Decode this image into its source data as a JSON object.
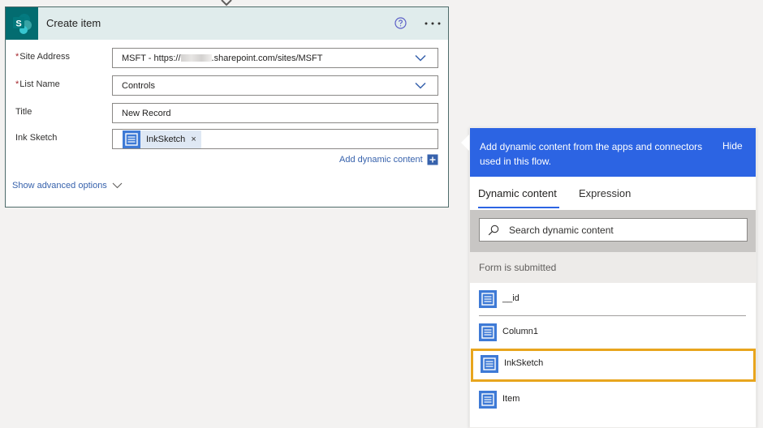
{
  "card": {
    "title": "Create item",
    "icons": {
      "logo": "sharepoint-logo",
      "help": "help-circle-icon",
      "more": "more-options-icon"
    },
    "fields": {
      "site_address": {
        "label": "Site Address",
        "required": "*",
        "value_prefix": "MSFT - https://",
        "value_suffix": ".sharepoint.com/sites/MSFT"
      },
      "list_name": {
        "label": "List Name",
        "required": "*",
        "value": "Controls"
      },
      "title": {
        "label": "Title",
        "value": "New Record"
      },
      "ink_sketch": {
        "label": "Ink Sketch",
        "token": "InkSketch",
        "remove": "×"
      }
    },
    "add_dynamic_content": "Add dynamic content",
    "show_advanced": "Show advanced options"
  },
  "panel": {
    "header_text": "Add dynamic content from the apps and connectors used in this flow.",
    "hide_label": "Hide",
    "tabs": [
      {
        "label": "Dynamic content",
        "active": true
      },
      {
        "label": "Expression",
        "active": false
      }
    ],
    "search": {
      "placeholder": "Search dynamic content"
    },
    "section": "Form is submitted",
    "items": [
      {
        "label": "__id",
        "selected": false
      },
      {
        "label": "Column1",
        "selected": false
      },
      {
        "label": "InkSketch",
        "selected": true
      },
      {
        "label": "Item",
        "selected": false
      }
    ]
  },
  "colors": {
    "panel_header": "#2c64e3",
    "sharepoint": "#036c70",
    "selection_outline": "#e8a51d",
    "link": "#3762ac",
    "required": "#a4262c"
  }
}
